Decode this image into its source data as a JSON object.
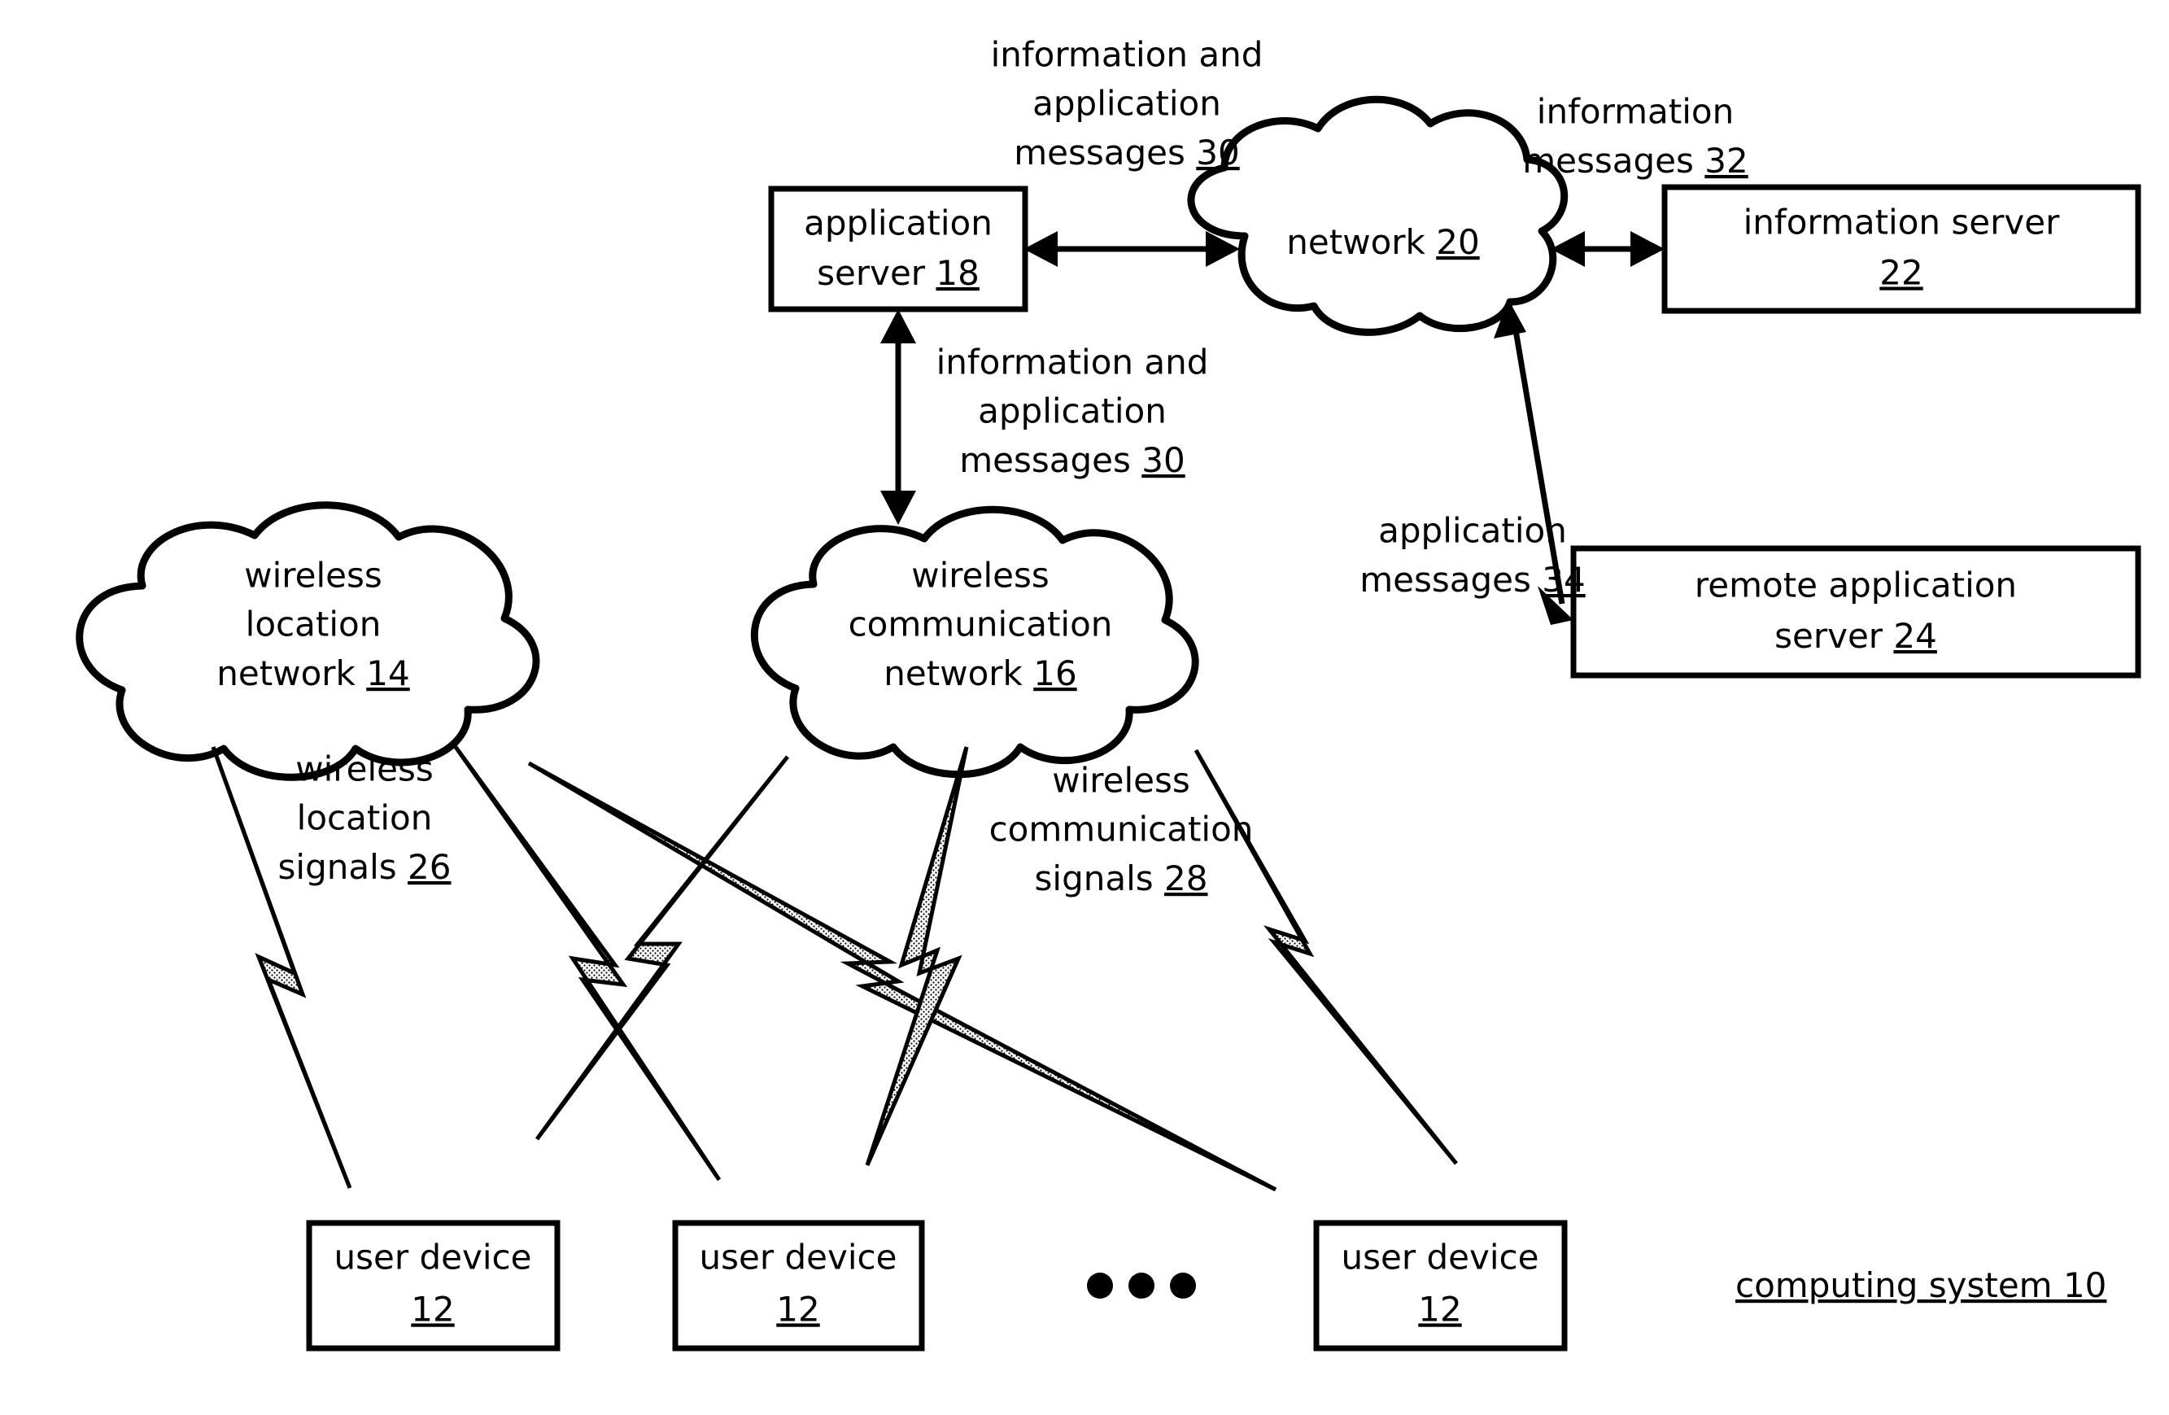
{
  "figure": {
    "caption": "computing system 10",
    "caption_label": "computing system",
    "caption_ref": "10",
    "ellipsis": "●●●",
    "colors": {
      "stroke": "#000000",
      "background": "#ffffff",
      "fill": "#ffffff"
    }
  },
  "nodes": {
    "application_server": {
      "shape": "rectangle",
      "label_line1": "application",
      "label_line2": "server",
      "ref": "18"
    },
    "network": {
      "shape": "cloud",
      "label_line1": "network",
      "ref": "20"
    },
    "information_server": {
      "shape": "rectangle",
      "label_line1": "information server",
      "ref": "22"
    },
    "remote_application_server": {
      "shape": "rectangle",
      "label_line1": "remote application",
      "label_line2": "server",
      "ref": "24"
    },
    "wireless_location_network": {
      "shape": "cloud",
      "label_line1": "wireless",
      "label_line2": "location",
      "label_line3": "network",
      "ref": "14"
    },
    "wireless_communication_network": {
      "shape": "cloud",
      "label_line1": "wireless",
      "label_line2": "communication",
      "label_line3": "network",
      "ref": "16"
    },
    "user_device_1": {
      "shape": "rectangle",
      "label_line1": "user device",
      "ref": "12"
    },
    "user_device_2": {
      "shape": "rectangle",
      "label_line1": "user device",
      "ref": "12"
    },
    "user_device_3": {
      "shape": "rectangle",
      "label_line1": "user device",
      "ref": "12"
    }
  },
  "connection_labels": {
    "appserver_network": {
      "line1": "information and",
      "line2": "application",
      "line3": "messages",
      "ref": "30"
    },
    "appserver_wcn": {
      "line1": "information and",
      "line2": "application",
      "line3": "messages",
      "ref": "30"
    },
    "network_infoserver": {
      "line1": "information",
      "line2": "messages",
      "ref": "32"
    },
    "network_remoteserver": {
      "line1": "application",
      "line2": "messages",
      "ref": "34"
    },
    "wireless_location_signals": {
      "line1": "wireless",
      "line2": "location",
      "line3": "signals",
      "ref": "26"
    },
    "wireless_communication_signals": {
      "line1": "wireless",
      "line2": "communication",
      "line3": "signals",
      "ref": "28"
    }
  }
}
